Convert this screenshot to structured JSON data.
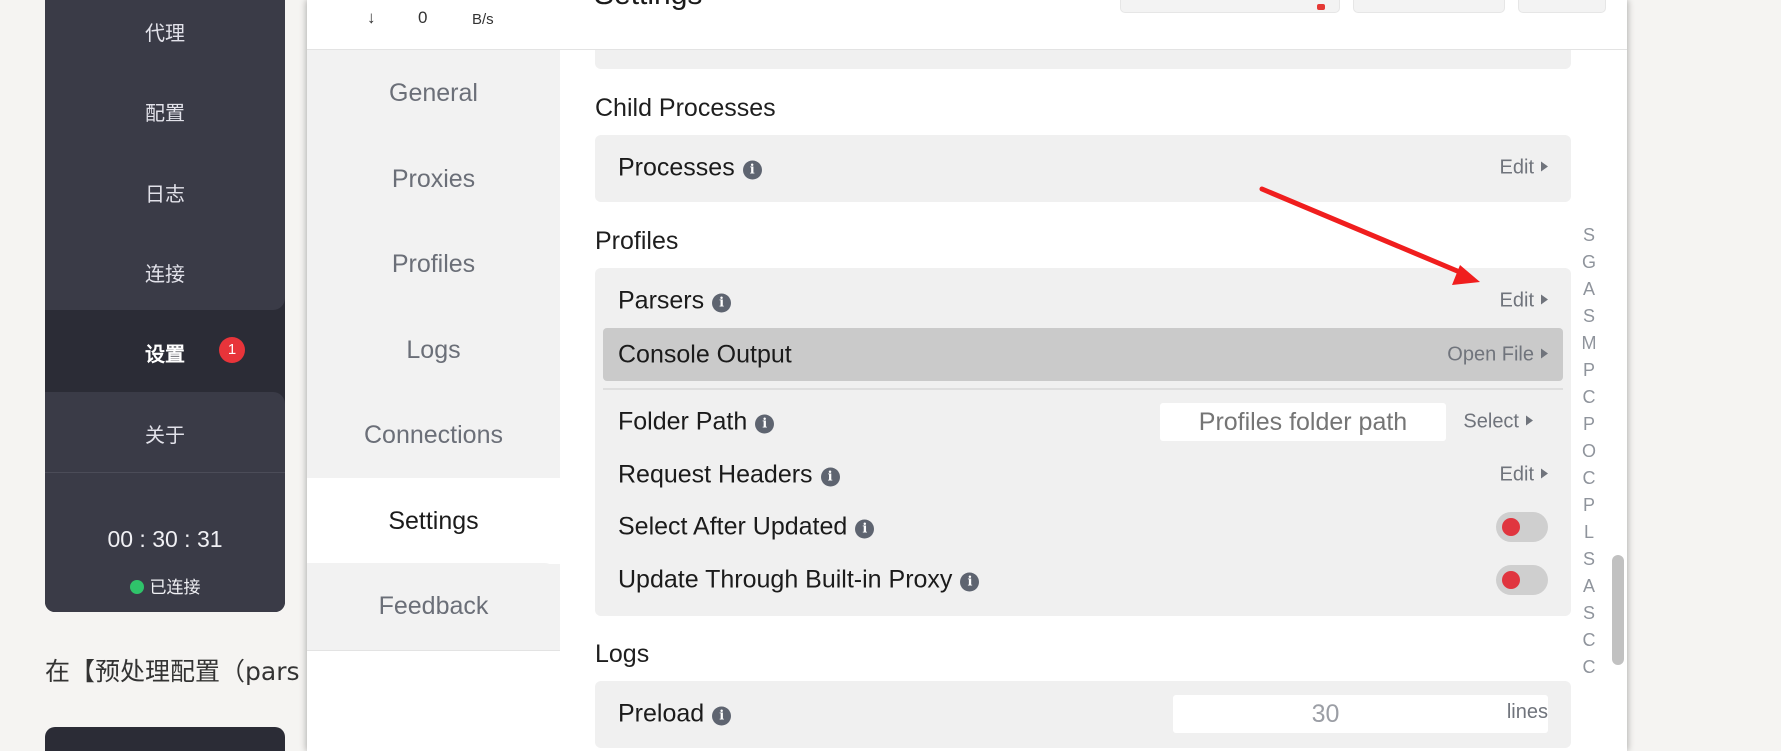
{
  "left_app": {
    "items": [
      "代理",
      "配置",
      "日志",
      "连接",
      "设置",
      "关于"
    ],
    "settings_badge": "1",
    "timer": "00 : 30 : 31",
    "status": "已连接"
  },
  "below_text": "在【预处理配置（pars",
  "window": {
    "speed": {
      "arrow": "↓",
      "value": "0",
      "unit": "B/s"
    },
    "title": "Settings",
    "nav": [
      "General",
      "Proxies",
      "Profiles",
      "Logs",
      "Connections",
      "Settings",
      "Feedback"
    ],
    "active_nav": "Settings"
  },
  "sections": {
    "child_processes": {
      "title": "Child Processes",
      "processes_label": "Processes",
      "processes_action": "Edit"
    },
    "profiles": {
      "title": "Profiles",
      "parsers_label": "Parsers",
      "parsers_action": "Edit",
      "console_output_label": "Console Output",
      "console_output_action": "Open File",
      "folder_path_label": "Folder Path",
      "folder_path_placeholder": "Profiles folder path",
      "folder_path_action": "Select",
      "request_headers_label": "Request Headers",
      "request_headers_action": "Edit",
      "select_after_updated_label": "Select After Updated",
      "update_through_proxy_label": "Update Through Built-in Proxy"
    },
    "logs": {
      "title": "Logs",
      "preload_label": "Preload",
      "preload_value": "30",
      "preload_unit": "lines"
    }
  },
  "index_letters": [
    "S",
    "G",
    "A",
    "S",
    "M",
    "P",
    "C",
    "P",
    "O",
    "C",
    "P",
    "L",
    "S",
    "A",
    "S",
    "C",
    "C"
  ],
  "colors": {
    "accent_red": "#e0353f",
    "annotation_arrow": "#f01e1e",
    "status_green": "#2fc36a"
  }
}
